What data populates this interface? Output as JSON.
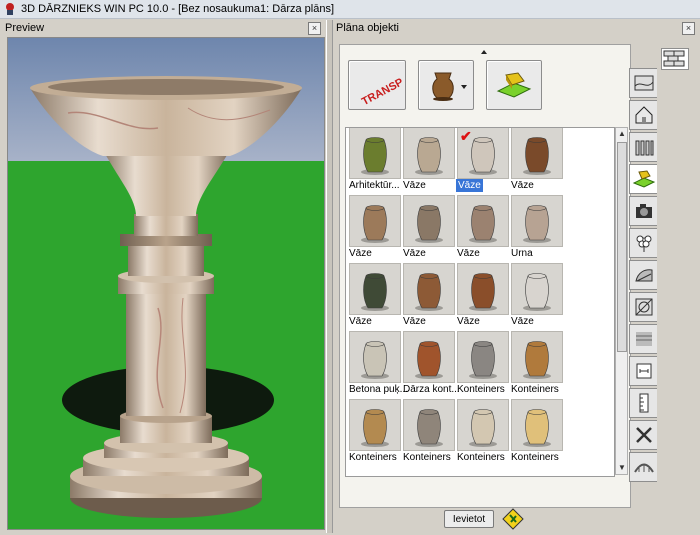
{
  "window": {
    "title": "3D DĀRZNIEKS WIN PC 10.0 - [Bez nosaukuma1: Dārza plāns]"
  },
  "preview": {
    "title": "Preview",
    "close_label": "×"
  },
  "objects": {
    "title": "Plāna objekti",
    "close_label": "×",
    "transport_label": "TRANSP",
    "items": [
      [
        "Arhitektūr...",
        "Vāze",
        "Vāze",
        "Vāze"
      ],
      [
        "Vāze",
        "Vāze",
        "Vāze",
        "Urna"
      ],
      [
        "Vāze",
        "Vāze",
        "Vāze",
        "Vāze"
      ],
      [
        "Betona puķ...",
        "Dārza kont...",
        "Konteiners",
        "Konteiners"
      ],
      [
        "Konteiners",
        "Konteiners",
        "Konteiners",
        "Konteiners"
      ]
    ],
    "selected": {
      "row": 0,
      "col": 2
    },
    "insert_button": "Ievietot"
  },
  "colors": {
    "selection": "#3875d7",
    "sky": "#7d90b3",
    "grass": "#2ea52e",
    "marble": "#c9b49c"
  },
  "icons": [
    "app-icon",
    "transport-icon",
    "vase-dropdown-icon",
    "place-object-icon",
    "checkmark-icon",
    "garden-tool-sign-icon"
  ]
}
